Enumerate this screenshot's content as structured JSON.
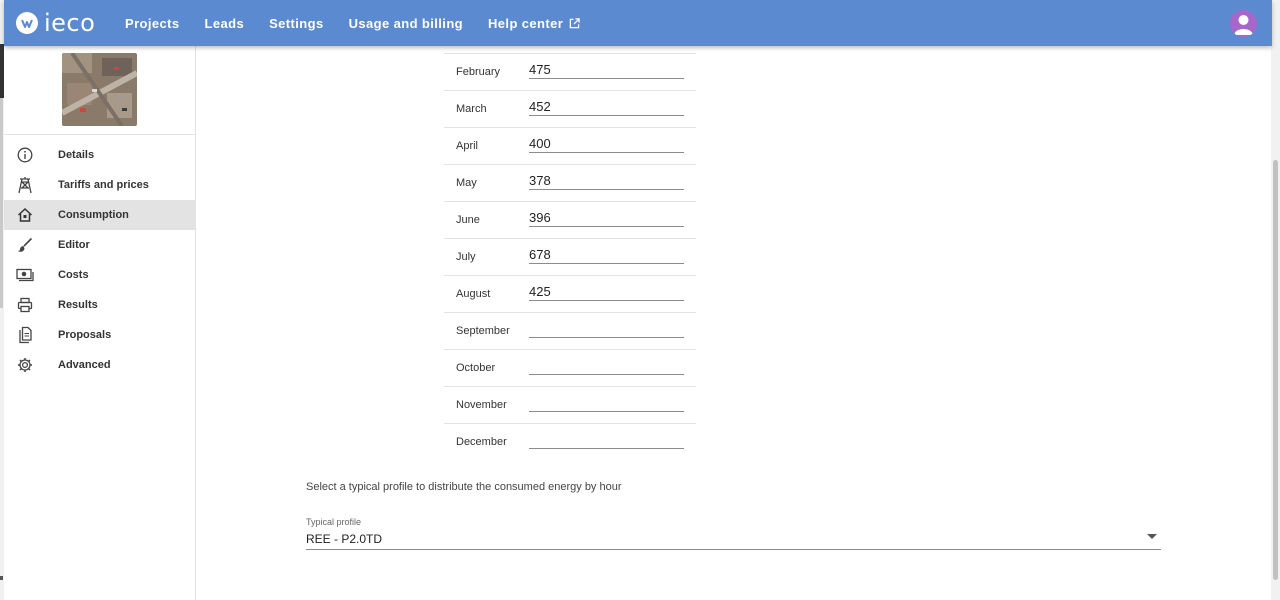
{
  "header": {
    "logo_text": "ieco",
    "nav": [
      "Projects",
      "Leads",
      "Settings",
      "Usage and billing",
      "Help center"
    ]
  },
  "sidebar": {
    "items": [
      {
        "label": "Details",
        "icon": "info-icon"
      },
      {
        "label": "Tariffs and prices",
        "icon": "power-tower-icon"
      },
      {
        "label": "Consumption",
        "icon": "home-icon",
        "active": true
      },
      {
        "label": "Editor",
        "icon": "brush-icon"
      },
      {
        "label": "Costs",
        "icon": "cash-icon"
      },
      {
        "label": "Results",
        "icon": "printer-icon"
      },
      {
        "label": "Proposals",
        "icon": "documents-icon"
      },
      {
        "label": "Advanced",
        "icon": "gear-icon"
      }
    ]
  },
  "consumption": {
    "months": [
      {
        "name": "February",
        "value": "475"
      },
      {
        "name": "March",
        "value": "452"
      },
      {
        "name": "April",
        "value": "400"
      },
      {
        "name": "May",
        "value": "378"
      },
      {
        "name": "June",
        "value": "396"
      },
      {
        "name": "July",
        "value": "678"
      },
      {
        "name": "August",
        "value": "425"
      },
      {
        "name": "September",
        "value": ""
      },
      {
        "name": "October",
        "value": ""
      },
      {
        "name": "November",
        "value": ""
      },
      {
        "name": "December",
        "value": ""
      }
    ],
    "profile_prompt": "Select a typical profile to distribute the consumed energy by hour",
    "profile_label": "Typical profile",
    "profile_value": "REE - P2.0TD"
  },
  "colors": {
    "appbar": "#5b8ad0",
    "active_menu": "#e3e3e3",
    "avatar": "#a567c9"
  }
}
